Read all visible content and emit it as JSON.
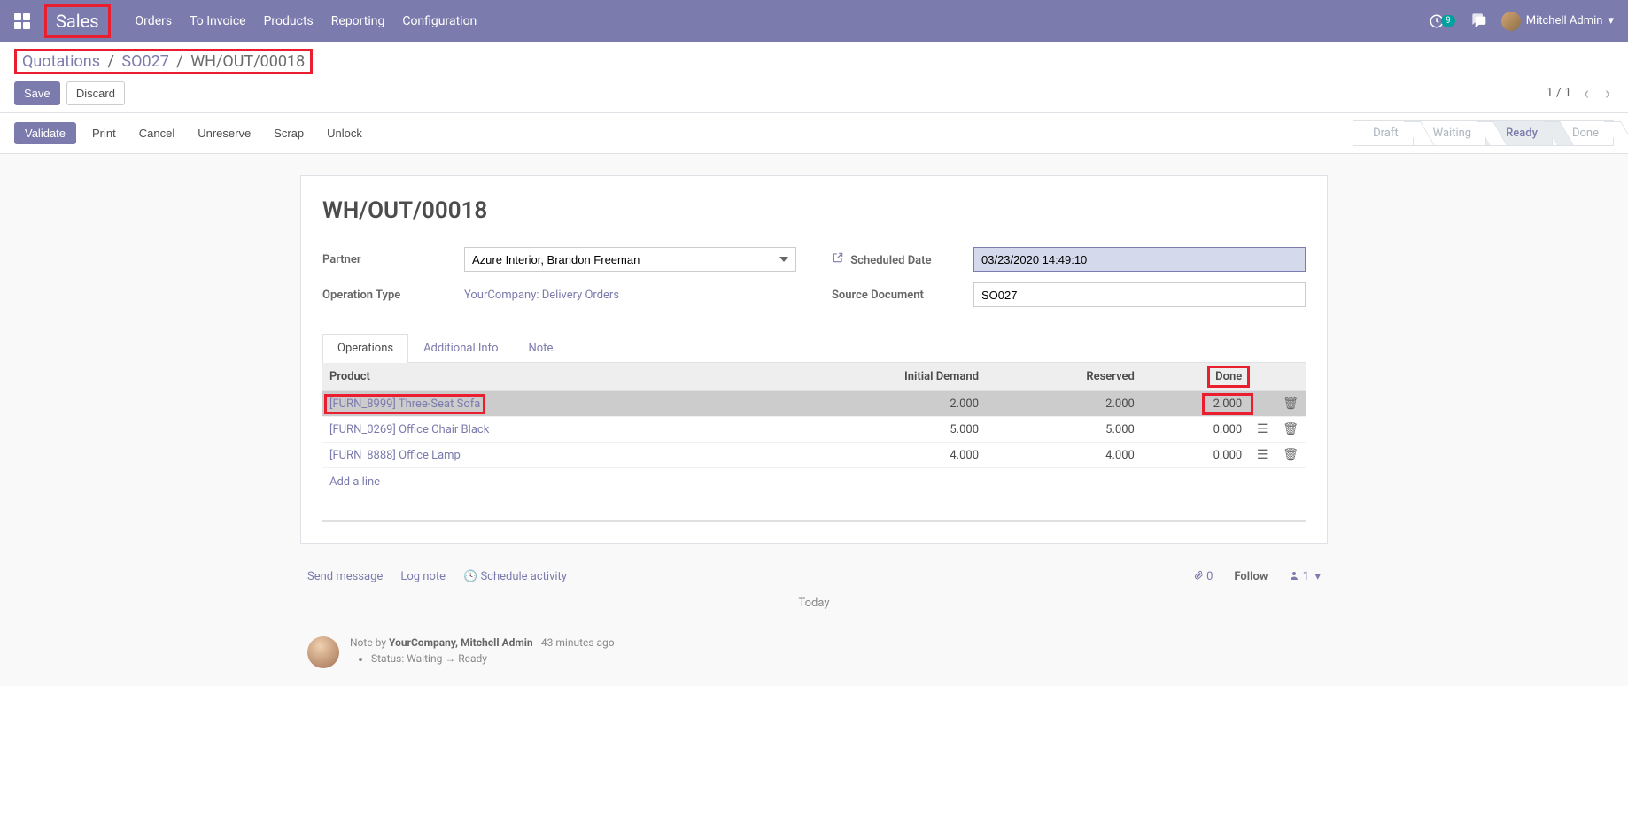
{
  "nav": {
    "brand": "Sales",
    "menu": [
      "Orders",
      "To Invoice",
      "Products",
      "Reporting",
      "Configuration"
    ],
    "activity_count": "9",
    "user_name": "Mitchell Admin"
  },
  "breadcrumb": {
    "items": [
      "Quotations",
      "SO027",
      "WH/OUT/00018"
    ]
  },
  "control": {
    "save": "Save",
    "discard": "Discard",
    "pager": "1 / 1"
  },
  "actions": {
    "validate": "Validate",
    "print": "Print",
    "cancel": "Cancel",
    "unreserve": "Unreserve",
    "scrap": "Scrap",
    "unlock": "Unlock"
  },
  "status": {
    "draft": "Draft",
    "waiting": "Waiting",
    "ready": "Ready",
    "done": "Done"
  },
  "form": {
    "title": "WH/OUT/00018",
    "partner_label": "Partner",
    "partner_value": "Azure Interior, Brandon Freeman",
    "optype_label": "Operation Type",
    "optype_value": "YourCompany: Delivery Orders",
    "sched_label": "Scheduled Date",
    "sched_value": "03/23/2020 14:49:10",
    "source_label": "Source Document",
    "source_value": "SO027"
  },
  "tabs": {
    "operations": "Operations",
    "additional": "Additional Info",
    "note": "Note"
  },
  "table": {
    "headers": {
      "product": "Product",
      "initial": "Initial Demand",
      "reserved": "Reserved",
      "done": "Done"
    },
    "rows": [
      {
        "product": "[FURN_8999] Three-Seat Sofa",
        "initial": "2.000",
        "reserved": "2.000",
        "done": "2.000",
        "selected": true,
        "hl": true,
        "details": false
      },
      {
        "product": "[FURN_0269] Office Chair Black",
        "initial": "5.000",
        "reserved": "5.000",
        "done": "0.000",
        "selected": false,
        "hl": false,
        "details": true
      },
      {
        "product": "[FURN_8888] Office Lamp",
        "initial": "4.000",
        "reserved": "4.000",
        "done": "0.000",
        "selected": false,
        "hl": false,
        "details": true
      }
    ],
    "add_line": "Add a line"
  },
  "chatter": {
    "send": "Send message",
    "log": "Log note",
    "schedule": "Schedule activity",
    "attach_count": "0",
    "follow": "Follow",
    "follower_count": "1",
    "today": "Today",
    "note_prefix": "Note by",
    "note_author": "YourCompany, Mitchell Admin",
    "note_time": "43 minutes ago",
    "status_line": "Status: Waiting → Ready"
  }
}
